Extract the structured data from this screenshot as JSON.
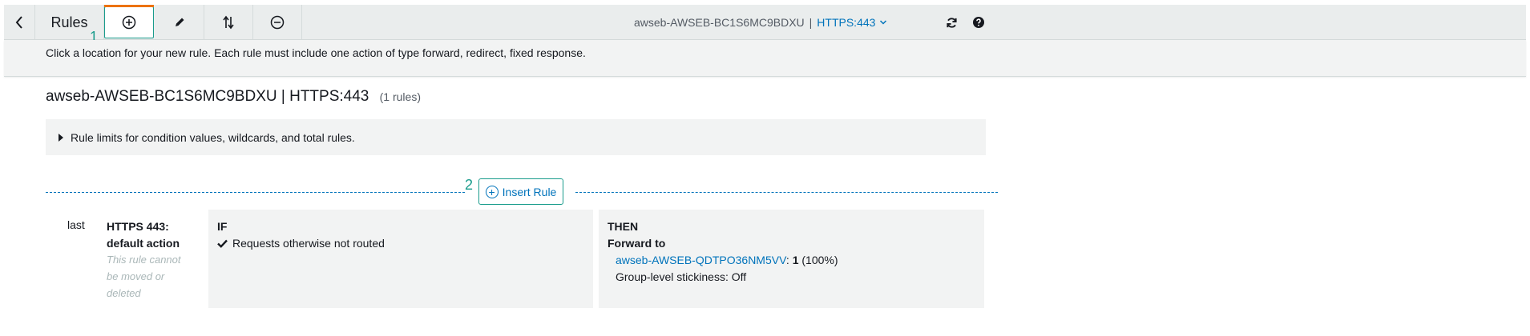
{
  "toolbar": {
    "title": "Rules",
    "load_balancer": "awseb-AWSEB-BC1S6MC9BDXU",
    "separator": "|",
    "listener": "HTTPS:443"
  },
  "steps": {
    "step1": "1",
    "step2": "2"
  },
  "info_text": "Click a location for your new rule. Each rule must include one action of type forward, redirect, fixed response.",
  "heading": {
    "title": "awseb-AWSEB-BC1S6MC9BDXU | HTTPS:443",
    "rule_count": "(1 rules)"
  },
  "limits_label": "Rule limits for condition values, wildcards, and total rules.",
  "insert_rule_label": "Insert Rule",
  "rule": {
    "order": "last",
    "name_line1": "HTTPS 443:",
    "name_line2": "default action",
    "note": "This rule cannot be moved or deleted",
    "if_label": "IF",
    "condition": "Requests otherwise not routed",
    "then_label": "THEN",
    "action": "Forward to",
    "target_group": "awseb-AWSEB-QDTPO36NM5VV",
    "colon": ":",
    "weight": "1",
    "weight_pct": "(100%)",
    "stickiness": "Group-level stickiness: Off"
  },
  "colors": {
    "accent_teal": "#1a9c8c",
    "link_blue": "#0073bb",
    "active_orange": "#ec7211",
    "panel_gray": "#f2f3f3"
  },
  "icons": {
    "back": "chevron-left-icon",
    "add": "plus-circle-icon",
    "edit": "pencil-icon",
    "reorder": "sort-arrows-icon",
    "delete": "minus-circle-icon",
    "refresh": "refresh-icon",
    "help": "help-circle-icon",
    "expand": "caret-right-icon",
    "check": "check-icon"
  }
}
